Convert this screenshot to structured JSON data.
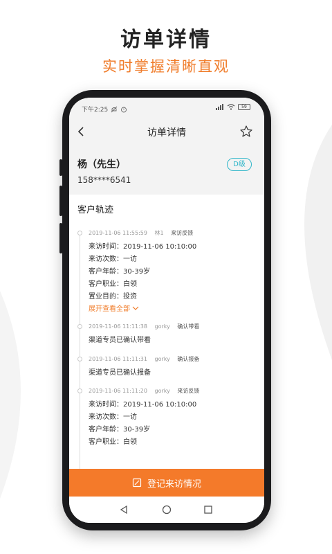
{
  "hero": {
    "title": "访单详情",
    "subtitle": "实时掌握清晰直观"
  },
  "status_bar": {
    "time": "下午2:25",
    "battery": "59"
  },
  "nav": {
    "title": "访单详情"
  },
  "customer": {
    "name": "杨（先生）",
    "phone": "158****6541",
    "level": "D级"
  },
  "section_title": "客户轨迹",
  "timeline": [
    {
      "time": "2019-11-06 11:55:59",
      "user": "林1",
      "type": "来访反馈",
      "lines": [
        "来访时间：2019-11-06 10:10:00",
        "来访次数：一访",
        "客户年龄：30-39岁",
        "客户职业：白领",
        "置业目的：投资"
      ],
      "expand": "展开查看全部"
    },
    {
      "time": "2019-11-06 11:11:38",
      "user": "gorky",
      "type": "确认带看",
      "lines": [
        "渠道专员已确认带看"
      ]
    },
    {
      "time": "2019-11-06 11:11:31",
      "user": "gorky",
      "type": "确认报备",
      "lines": [
        "渠道专员已确认报备"
      ]
    },
    {
      "time": "2019-11-06 11:11:20",
      "user": "gorky",
      "type": "来访反馈",
      "lines": [
        "来访时间：2019-11-06 10:10:00",
        "来访次数：一访",
        "客户年龄：30-39岁",
        "客户职业：白领"
      ]
    }
  ],
  "bottom_button": {
    "label": "登记来访情况"
  },
  "colors": {
    "accent": "#f47a2a",
    "badge": "#2fb6c9",
    "screen_bg": "#f3f3f3"
  }
}
